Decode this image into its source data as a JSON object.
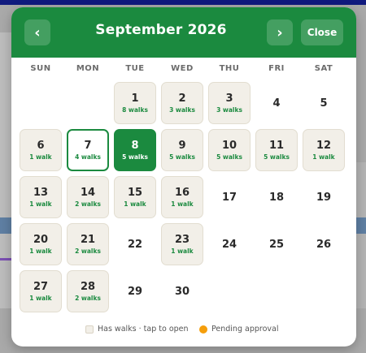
{
  "calendar": {
    "title": "September 2026",
    "prev_label": "‹",
    "next_label": "›",
    "close_label": "Close",
    "weekdays": [
      "SUN",
      "MON",
      "TUE",
      "WED",
      "THU",
      "FRI",
      "SAT"
    ],
    "days": [
      {
        "day": "1",
        "walks": "8 walks"
      },
      {
        "day": "2",
        "walks": "3 walks"
      },
      {
        "day": "3",
        "walks": "3 walks"
      },
      {
        "day": "4",
        "walks": ""
      },
      {
        "day": "5",
        "walks": ""
      },
      {
        "day": "6",
        "walks": "1 walk"
      },
      {
        "day": "7",
        "walks": "4 walks",
        "today": true
      },
      {
        "day": "8",
        "walks": "5 walks",
        "selected": true
      },
      {
        "day": "9",
        "walks": "5 walks"
      },
      {
        "day": "10",
        "walks": "5 walks"
      },
      {
        "day": "11",
        "walks": "5 walks"
      },
      {
        "day": "12",
        "walks": "1 walk"
      },
      {
        "day": "13",
        "walks": "1 walk"
      },
      {
        "day": "14",
        "walks": "2 walks"
      },
      {
        "day": "15",
        "walks": "1 walk"
      },
      {
        "day": "16",
        "walks": "1 walk"
      },
      {
        "day": "17",
        "walks": ""
      },
      {
        "day": "18",
        "walks": ""
      },
      {
        "day": "19",
        "walks": ""
      },
      {
        "day": "20",
        "walks": "1 walk"
      },
      {
        "day": "21",
        "walks": "2 walks"
      },
      {
        "day": "22",
        "walks": ""
      },
      {
        "day": "23",
        "walks": "1 walk"
      },
      {
        "day": "24",
        "walks": ""
      },
      {
        "day": "25",
        "walks": ""
      },
      {
        "day": "26",
        "walks": ""
      },
      {
        "day": "27",
        "walks": "1 walk"
      },
      {
        "day": "28",
        "walks": "2 walks"
      },
      {
        "day": "29",
        "walks": ""
      },
      {
        "day": "30",
        "walks": ""
      }
    ],
    "first_weekday_index": 2,
    "legend": {
      "has_walks": "Has walks · tap to open",
      "pending": "Pending approval"
    },
    "colors": {
      "header": "#1b8a3f",
      "pending": "#f59e0b",
      "has_walks_bg": "#f2efe8"
    }
  }
}
